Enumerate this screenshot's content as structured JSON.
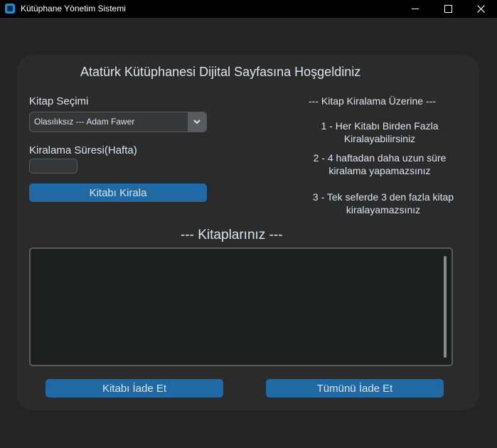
{
  "window": {
    "title": "Kütüphane Yönetim Sistemi"
  },
  "heading": "Atatürk Kütüphanesi Dijital Sayfasına Hoşgeldiniz",
  "book_select": {
    "label": "Kitap Seçimi",
    "selected": "Olasılıksız --- Adam Fawer"
  },
  "duration": {
    "label": "Kiralama Süresi(Hafta)",
    "value": ""
  },
  "rent_button": "Kitabı Kirala",
  "rules": {
    "title": "--- Kitap Kiralama Üzerine ---",
    "items": [
      {
        "line1": "1 - Her Kitabı Birden Fazla",
        "line2": "Kiralayabilirsiniz"
      },
      {
        "line1": "2 - 4 haftadan daha uzun süre",
        "line2": "kiralama yapamazsınız"
      },
      {
        "line1": "3 - Tek seferde 3 den fazla kitap",
        "line2": "kiralayamazsınız"
      }
    ]
  },
  "books": {
    "title": "--- Kitaplarınız ---",
    "items": []
  },
  "return_button": "Kitabı İade Et",
  "return_all_button": "Tümünü İade Et"
}
